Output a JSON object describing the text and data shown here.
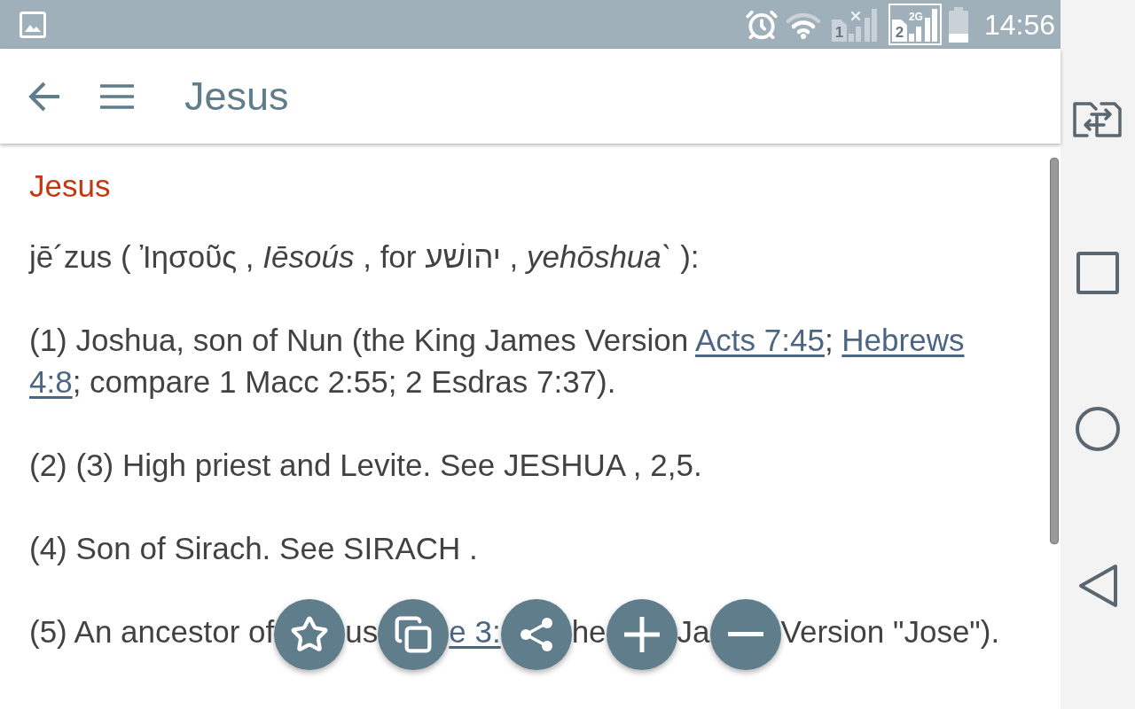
{
  "status_bar": {
    "sims": [
      {
        "label": "1",
        "selected": false,
        "no_service": true
      },
      {
        "label": "2",
        "selected": true,
        "no_service": false,
        "network": "2G"
      }
    ],
    "time": "14:56"
  },
  "app_bar": {
    "title": "Jesus"
  },
  "article": {
    "heading": "Jesus",
    "paragraphs": [
      {
        "kind": "text",
        "runs": [
          {
            "kind": "text",
            "text": "jē´zus ( Ἰησοῦς , *Iēsoús* , for יהושׁע , *yehōshua`* ):"
          }
        ]
      },
      {
        "kind": "text",
        "runs": [
          {
            "kind": "text",
            "text": "(1) Joshua, son of Nun (the King James Version "
          },
          {
            "kind": "link",
            "text": "Acts 7:45"
          },
          {
            "kind": "text",
            "text": "; "
          },
          {
            "kind": "link",
            "text": "Hebrews"
          },
          {
            "kind": "link",
            "text": "4:8"
          },
          {
            "kind": "text",
            "text": "; compare 1 Macc 2:55; 2 Esdras 7:37)."
          }
        ]
      },
      {
        "kind": "text",
        "runs": [
          {
            "kind": "text",
            "text": "(2) (3) High priest and Levite. See JESHUA , 2,5."
          }
        ]
      },
      {
        "kind": "text",
        "runs": [
          {
            "kind": "text",
            "text": "(4) Son of Sirach. See SIRACH ."
          }
        ]
      },
      {
        "kind": "covered",
        "fragments": [
          {
            "kind": "text",
            "text": "(5) An ancestor of"
          },
          {
            "kind": "text",
            "text": "us"
          },
          {
            "kind": "link",
            "text": "e 3:"
          },
          {
            "kind": "text",
            "text": "he"
          },
          {
            "kind": "text",
            "text": "Ja"
          },
          {
            "kind": "text",
            "text": "Version \"Jose\")."
          }
        ]
      }
    ]
  },
  "action_buttons": [
    {
      "kind": "favorite"
    },
    {
      "kind": "copy"
    },
    {
      "kind": "share"
    },
    {
      "kind": "zoom_in"
    },
    {
      "kind": "zoom_out"
    }
  ]
}
